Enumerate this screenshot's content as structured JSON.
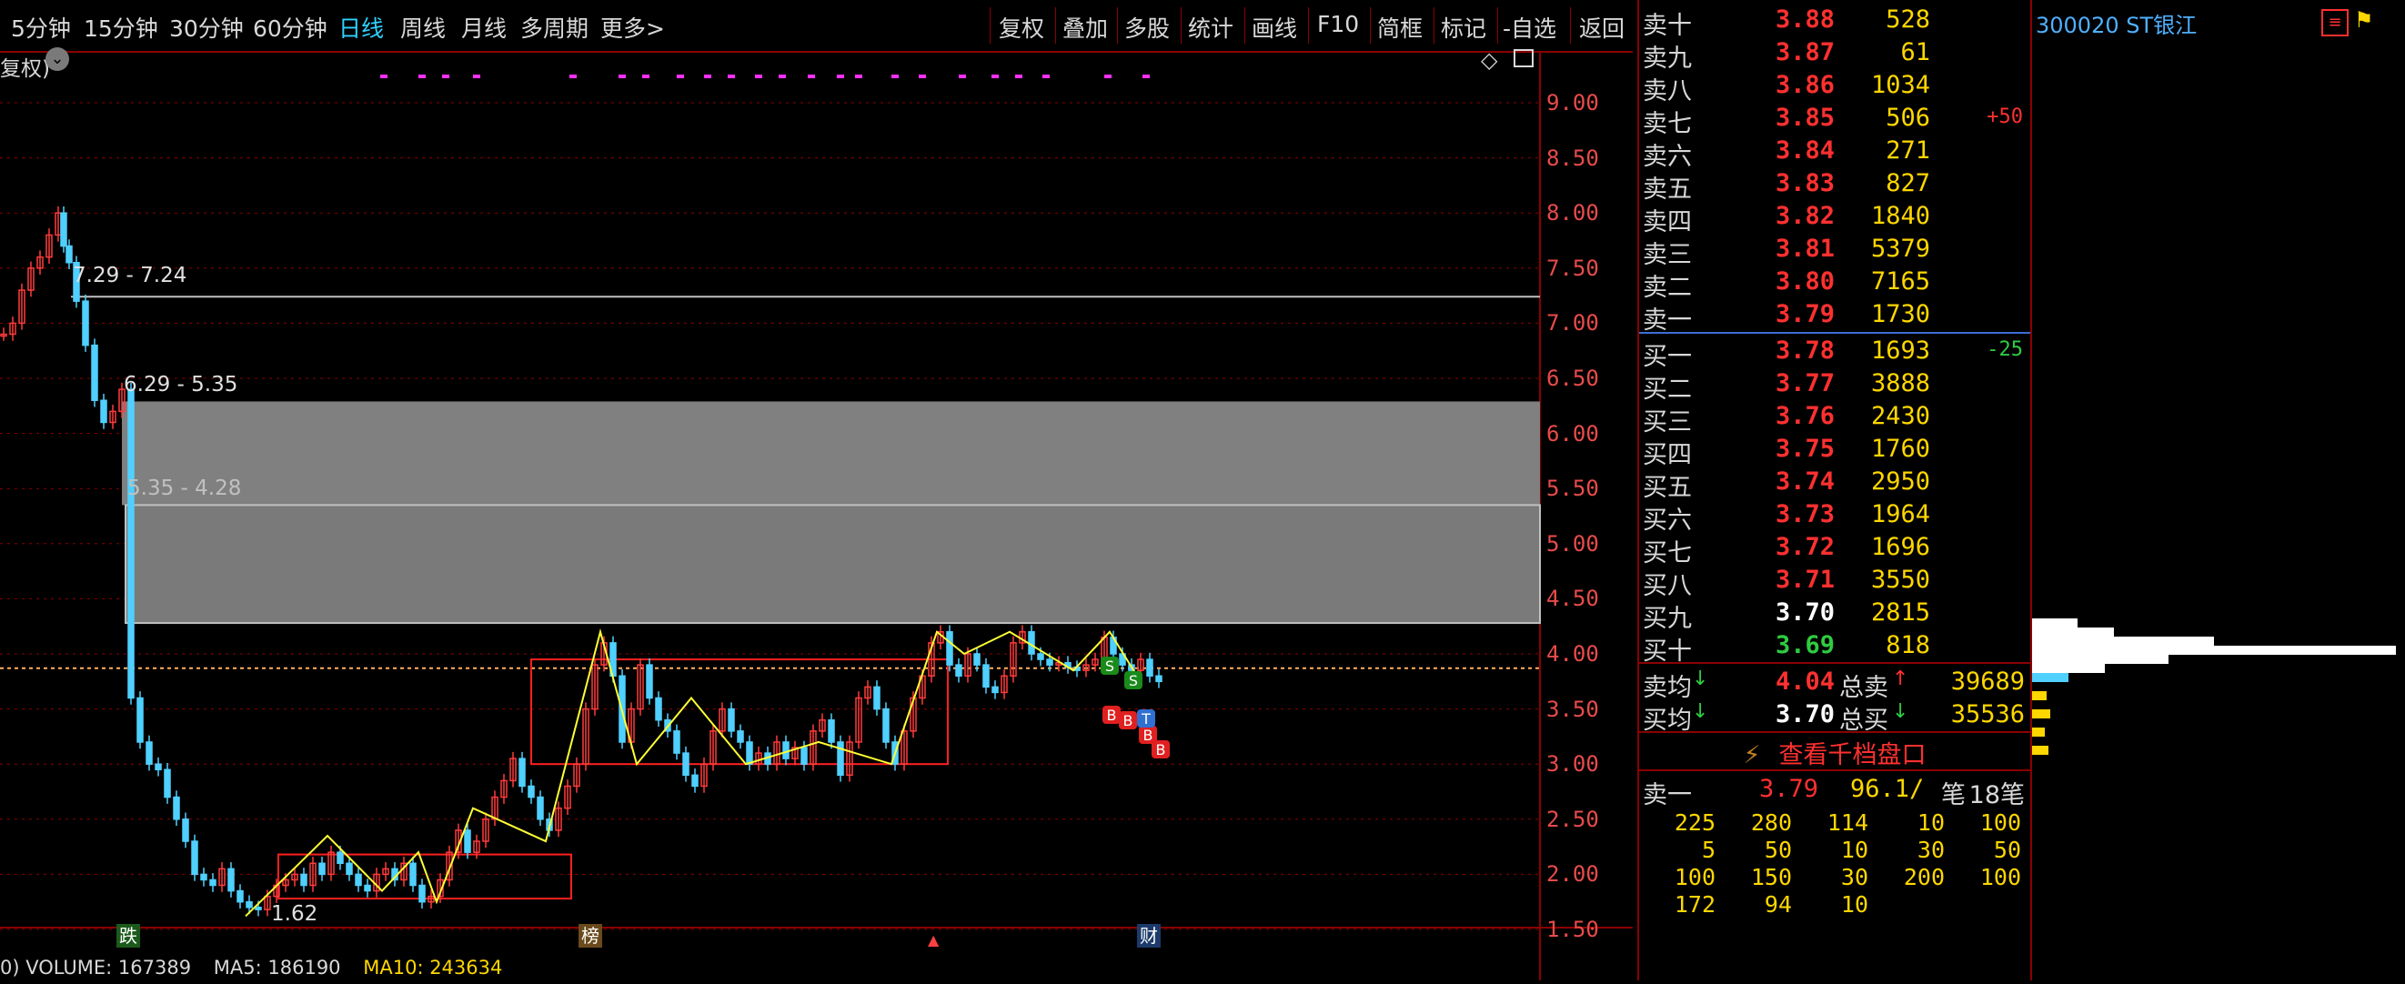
{
  "toolbar": {
    "periods": [
      "5分钟",
      "15分钟",
      "30分钟",
      "60分钟",
      "日线",
      "周线",
      "月线",
      "多周期",
      "更多>"
    ],
    "active_period": "日线",
    "tools": [
      "复权",
      "叠加",
      "多股",
      "统计",
      "画线",
      "F10",
      "简框",
      "标记",
      "-自选",
      "返回"
    ]
  },
  "chart": {
    "title_fragment": "复权)",
    "price_ticks": [
      "9.00",
      "8.50",
      "8.00",
      "7.50",
      "7.00",
      "6.50",
      "6.00",
      "5.50",
      "5.00",
      "4.50",
      "4.00",
      "3.50",
      "3.00",
      "2.50",
      "2.00",
      "1.50"
    ],
    "levels": [
      {
        "text": "7.29 - 7.24"
      },
      {
        "text": "6.29 - 5.35"
      },
      {
        "text": "5.35 - 4.28"
      }
    ],
    "low_label": "1.62",
    "event_markers": [
      "跌",
      "榜",
      "财"
    ],
    "signal_markers": {
      "sell": "S",
      "buy": "B",
      "t": "T"
    },
    "volume_bar": {
      "volume_label": "VOLUME: 167389",
      "ma5_label": "MA5: 186190",
      "ma10_label": "MA10: 243634"
    },
    "colors": {
      "price_up": "#ff3b3b",
      "price_down": "#4fd0ff",
      "ma_line": "#ffff33",
      "zone": "#808080",
      "box": "#ff2020"
    }
  },
  "order_book": {
    "sells": [
      {
        "label": "卖十",
        "price": "3.88",
        "volume": "528",
        "change": ""
      },
      {
        "label": "卖九",
        "price": "3.87",
        "volume": "61",
        "change": ""
      },
      {
        "label": "卖八",
        "price": "3.86",
        "volume": "1034",
        "change": ""
      },
      {
        "label": "卖七",
        "price": "3.85",
        "volume": "506",
        "change": "+50"
      },
      {
        "label": "卖六",
        "price": "3.84",
        "volume": "271",
        "change": ""
      },
      {
        "label": "卖五",
        "price": "3.83",
        "volume": "827",
        "change": ""
      },
      {
        "label": "卖四",
        "price": "3.82",
        "volume": "1840",
        "change": ""
      },
      {
        "label": "卖三",
        "price": "3.81",
        "volume": "5379",
        "change": ""
      },
      {
        "label": "卖二",
        "price": "3.80",
        "volume": "7165",
        "change": ""
      },
      {
        "label": "卖一",
        "price": "3.79",
        "volume": "1730",
        "change": ""
      }
    ],
    "buys": [
      {
        "label": "买一",
        "price": "3.78",
        "volume": "1693",
        "change": "-25"
      },
      {
        "label": "买二",
        "price": "3.77",
        "volume": "3888",
        "change": ""
      },
      {
        "label": "买三",
        "price": "3.76",
        "volume": "2430",
        "change": ""
      },
      {
        "label": "买四",
        "price": "3.75",
        "volume": "1760",
        "change": ""
      },
      {
        "label": "买五",
        "price": "3.74",
        "volume": "2950",
        "change": ""
      },
      {
        "label": "买六",
        "price": "3.73",
        "volume": "1964",
        "change": ""
      },
      {
        "label": "买七",
        "price": "3.72",
        "volume": "1696",
        "change": ""
      },
      {
        "label": "买八",
        "price": "3.71",
        "volume": "3550",
        "change": ""
      },
      {
        "label": "买九",
        "price": "3.70",
        "volume": "2815",
        "change": ""
      },
      {
        "label": "买十",
        "price": "3.69",
        "volume": "818",
        "change": ""
      }
    ],
    "summary": {
      "avg_sell_label": "卖均",
      "avg_sell": "4.04",
      "total_sell_label": "总卖",
      "total_sell": "39689",
      "avg_buy_label": "买均",
      "avg_buy": "3.70",
      "total_buy_label": "总买",
      "total_buy": "35536"
    },
    "thousand_link": "查看千档盘口",
    "queue": {
      "label": "卖一",
      "price": "3.79",
      "avg": "96.1/",
      "avg_unit": "笔",
      "count": "18笔",
      "rows": [
        [
          "225",
          "280",
          "114",
          "10",
          "100"
        ],
        [
          "5",
          "50",
          "10",
          "30",
          "50"
        ],
        [
          "100",
          "150",
          "30",
          "200",
          "100"
        ],
        [
          "172",
          "94",
          "10",
          "",
          ""
        ]
      ]
    }
  },
  "depth_panel": {
    "stock_title": "300020 ST银江"
  }
}
